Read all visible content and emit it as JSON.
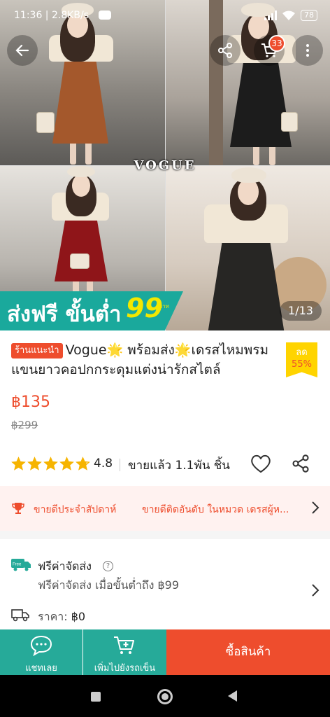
{
  "status_bar": {
    "time": "11:36",
    "speed": "2.8KB/s",
    "battery": "78"
  },
  "header": {
    "cart_count": "33"
  },
  "gallery": {
    "watermark": "VOGUE",
    "page_counter": "1/13"
  },
  "promo": {
    "text": "ส่งฟรี ขั้นต่ำ",
    "amount": "99",
    "unit": "บาท"
  },
  "product": {
    "tag": "ร้านแนะนำ",
    "title_parts": [
      "Vogue",
      "🌟",
      " พร้อมส่ง",
      "🌟",
      "เดรสไหมพรมแขนยาวคอปกกระดุมแต่งน่ารักสไตล์"
    ],
    "discount_label": "ลด",
    "discount_pct": "55%",
    "price": "฿135",
    "original_price": "฿299",
    "rating": "4.8",
    "rating_value": 4.8,
    "sold": "ขายแล้ว 1.1พัน ชิ้น"
  },
  "bestseller": {
    "item1": "ขายดีประจำสัปดาห์",
    "item2": "ขายดีติดอันดับ ในหมวด เดรสผู้ห..."
  },
  "shipping": {
    "title": "ฟรีค่าจัดส่ง",
    "help": "?",
    "subtitle": "ฟรีค่าจัดส่ง เมื่อขั้นต่ำถึง ฿99",
    "cost_label": "ราคา:",
    "cost_value": "฿0",
    "free_icon_text": "Free"
  },
  "actions": {
    "chat": "แชทเลย",
    "add_to_cart": "เพิ่มไปยังรถเข็น",
    "buy": "ซื้อสินค้า"
  },
  "colors": {
    "brand_orange": "#ee4d2d",
    "teal": "#26aa99",
    "star": "#f6b400"
  }
}
